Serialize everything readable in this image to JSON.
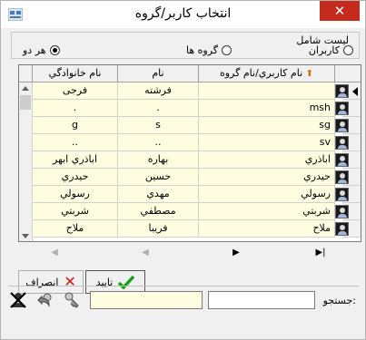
{
  "window": {
    "title": "انتخاب کاربر/گروه",
    "close_glyph": "✕"
  },
  "filter": {
    "legend": "ليست شامل",
    "options": [
      {
        "label": "کاربران",
        "selected": false
      },
      {
        "label": "گروه ها",
        "selected": false
      },
      {
        "label": "هر دو",
        "selected": true
      }
    ]
  },
  "grid": {
    "columns": {
      "user": "نام كاربري/نام گروه",
      "name": "نام",
      "family": "نام خانوادگي"
    },
    "rows": [
      {
        "user": "",
        "name": "فرشته",
        "family": "فرجى"
      },
      {
        "user": "msh",
        "name": ".",
        "family": "."
      },
      {
        "user": "sg",
        "name": "s",
        "family": "g"
      },
      {
        "user": "sv",
        "name": "..",
        "family": ".."
      },
      {
        "user": "اباذري",
        "name": "بهاره",
        "family": "اباذري ابهر"
      },
      {
        "user": "حيدري",
        "name": "حسين",
        "family": "حيدري"
      },
      {
        "user": "رسولي",
        "name": "مهدي",
        "family": "رسولي"
      },
      {
        "user": "شربتي",
        "name": "مصطفي",
        "family": "شربتي"
      },
      {
        "user": "ملاح",
        "name": "فريبا",
        "family": "ملاح"
      }
    ]
  },
  "navigator": {
    "first": "◀",
    "prev": "◀",
    "next": "▶",
    "last": "▶|"
  },
  "buttons": {
    "ok": "تاييد",
    "cancel": "انصراف"
  },
  "search": {
    "label": "جستجو:",
    "value": ""
  },
  "colors": {
    "row_bg": "#fffde0",
    "close_bg": "#c42b1c",
    "sort_arrow": "#d07000"
  },
  "icons": [
    "app-icon",
    "close-icon",
    "user-icon",
    "check-icon",
    "cancel-x-icon",
    "delete-user-icon",
    "undo-icon",
    "key-icon"
  ]
}
